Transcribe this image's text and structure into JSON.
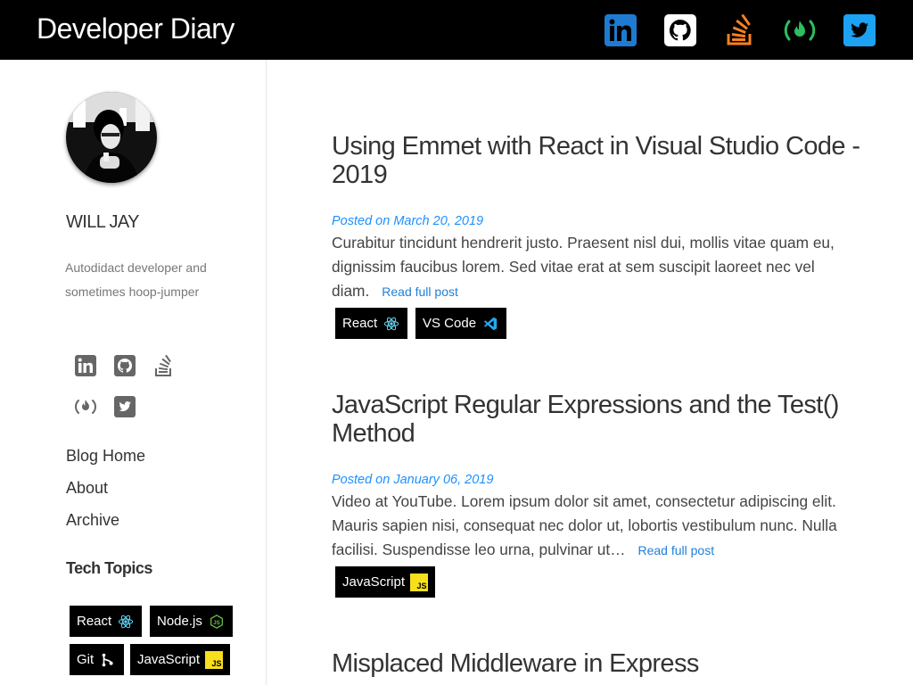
{
  "header": {
    "site_title": "Developer Diary",
    "social_icons": [
      "linkedin-icon",
      "github-icon",
      "stackoverflow-icon",
      "freecodecamp-icon",
      "twitter-icon"
    ]
  },
  "sidebar": {
    "author_name": "WILL JAY",
    "author_bio": "Autodidact developer and sometimes hoop-jumper",
    "social_icons": [
      "linkedin-icon",
      "github-icon",
      "stackoverflow-icon",
      "freecodecamp-icon",
      "twitter-icon"
    ],
    "nav": [
      {
        "label": "Blog Home"
      },
      {
        "label": "About"
      },
      {
        "label": "Archive"
      }
    ],
    "topics_heading": "Tech Topics",
    "topics": [
      {
        "label": "React",
        "icon": "react-icon"
      },
      {
        "label": "Node.js",
        "icon": "nodejs-icon"
      },
      {
        "label": "Git",
        "icon": "git-icon"
      },
      {
        "label": "JavaScript",
        "icon": "javascript-icon"
      }
    ]
  },
  "posts": [
    {
      "title": "Using Emmet with React in Visual Studio Code - 2019",
      "date": "Posted on March 20, 2019",
      "excerpt": "Curabitur tincidunt hendrerit justo. Praesent nisl dui, mollis vitae quam eu, dignissim faucibus lorem. Sed vitae erat at sem suscipit laoreet nec vel diam.",
      "read_more": "Read full post",
      "tags": [
        {
          "label": "React",
          "icon": "react-icon"
        },
        {
          "label": "VS Code",
          "icon": "vscode-icon"
        }
      ]
    },
    {
      "title": "JavaScript Regular Expressions and the Test() Method",
      "date": "Posted on January 06, 2019",
      "excerpt": "Video at YouTube. Lorem ipsum dolor sit amet, consectetur adipiscing elit. Mauris sapien nisi, consequat nec dolor ut, lobortis vestibulum nunc. Nulla facilisi. Suspendisse leo urna, pulvinar ut…",
      "read_more": "Read full post",
      "tags": [
        {
          "label": "JavaScript",
          "icon": "javascript-icon"
        }
      ]
    },
    {
      "title": "Misplaced Middleware in Express"
    }
  ],
  "colors": {
    "linkedin": "#0a66c2",
    "stackoverflow": "#f48024",
    "freecodecamp": "#2dbe60",
    "twitter": "#1da1f2",
    "link": "#1e90ff",
    "react": "#61dafb",
    "nodejs": "#6cc24a",
    "javascript": "#f7df1e",
    "vscode": "#23a9f2"
  }
}
